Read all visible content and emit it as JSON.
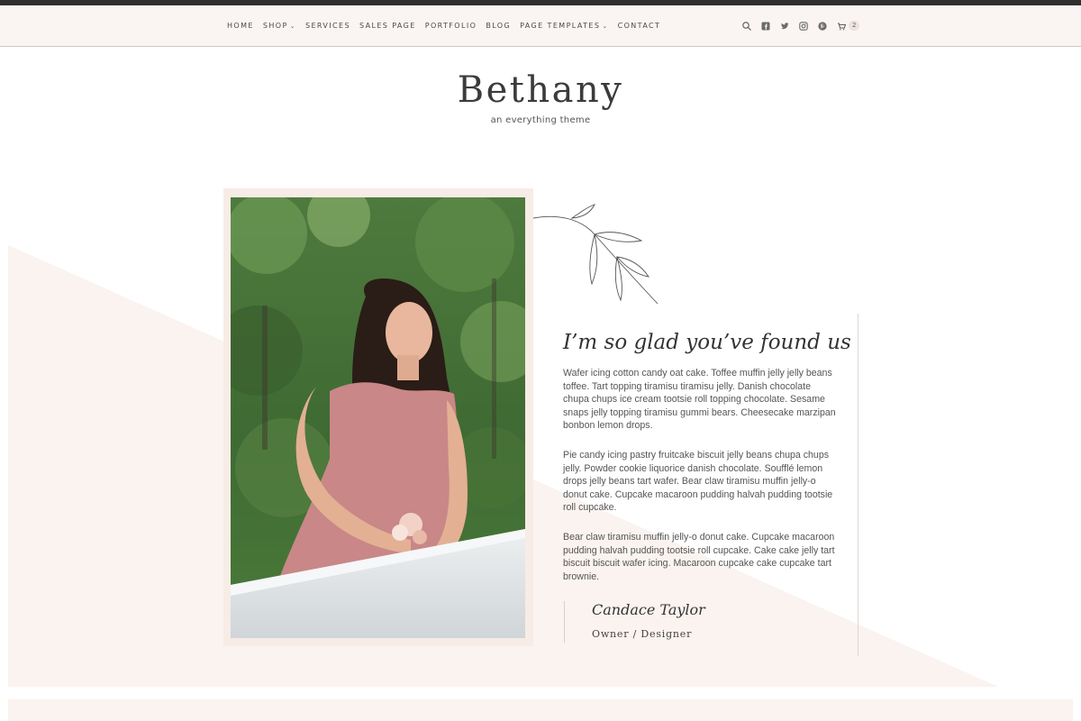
{
  "nav": {
    "items": [
      {
        "label": "HOME",
        "has_dropdown": false
      },
      {
        "label": "SHOP",
        "has_dropdown": true
      },
      {
        "label": "SERVICES",
        "has_dropdown": false
      },
      {
        "label": "SALES PAGE",
        "has_dropdown": false
      },
      {
        "label": "PORTFOLIO",
        "has_dropdown": false
      },
      {
        "label": "BLOG",
        "has_dropdown": false
      },
      {
        "label": "PAGE TEMPLATES",
        "has_dropdown": true
      },
      {
        "label": "CONTACT",
        "has_dropdown": false
      }
    ],
    "icons": [
      "search-icon",
      "facebook-icon",
      "twitter-icon",
      "instagram-icon",
      "pinterest-icon",
      "cart-icon"
    ],
    "cart_count": "2"
  },
  "brand": {
    "title": "Bethany",
    "tagline": "an everything theme"
  },
  "about": {
    "headline": "I’m so glad you’ve found us",
    "paragraphs": [
      "Wafer icing cotton candy oat cake. Toffee muffin jelly jelly beans toffee. Tart topping tiramisu tiramisu jelly. Danish chocolate chupa chups ice cream tootsie roll topping chocolate. Sesame snaps jelly topping tiramisu gummi bears. Cheesecake marzipan bonbon lemon drops.",
      "Pie candy icing pastry fruitcake biscuit jelly beans chupa chups jelly. Powder cookie liquorice danish chocolate. Soufflé lemon drops jelly beans tart wafer. Bear claw tiramisu muffin jelly-o donut cake. Cupcake macaroon pudding halvah pudding tootsie roll cupcake.",
      "Bear claw tiramisu muffin jelly-o donut cake. Cupcake macaroon pudding halvah pudding tootsie roll cupcake. Cake cake jelly tart biscuit biscuit wafer icing. Macaroon cupcake cake cupcake tart brownie."
    ],
    "signature_name": "Candace Taylor",
    "signature_role": "Owner / Designer"
  },
  "colors": {
    "header_bg": "#faf5f2",
    "blush": "#faf3ef",
    "frame": "#f7ece6",
    "text": "#3a3a3a"
  }
}
